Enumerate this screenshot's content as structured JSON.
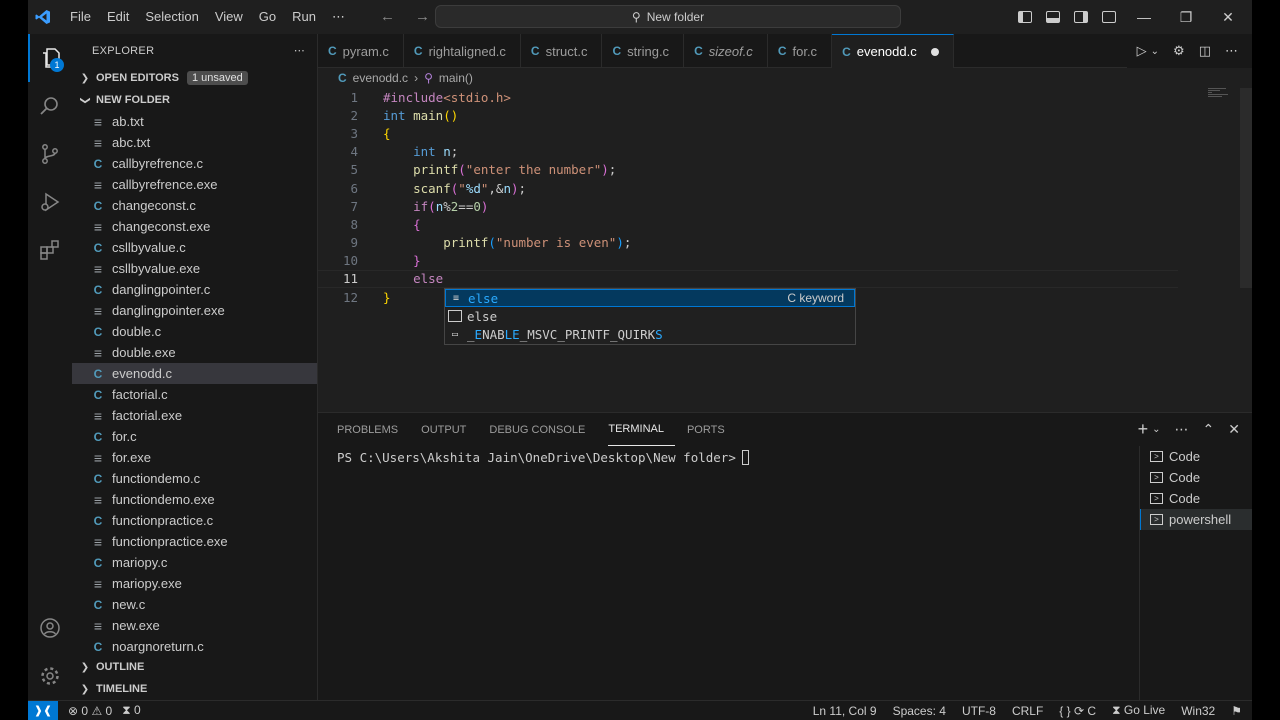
{
  "window": {
    "menu": [
      "File",
      "Edit",
      "Selection",
      "View",
      "Go",
      "Run",
      "⋯"
    ],
    "search": "New folder"
  },
  "explorer": {
    "title": "EXPLORER",
    "open_editors": "OPEN EDITORS",
    "unsaved": "1 unsaved",
    "folder": "NEW FOLDER",
    "files": [
      {
        "name": "ab.txt",
        "type": "txt"
      },
      {
        "name": "abc.txt",
        "type": "txt"
      },
      {
        "name": "callbyrefrence.c",
        "type": "c"
      },
      {
        "name": "callbyrefrence.exe",
        "type": "txt"
      },
      {
        "name": "changeconst.c",
        "type": "c"
      },
      {
        "name": "changeconst.exe",
        "type": "txt"
      },
      {
        "name": "csllbyvalue.c",
        "type": "c"
      },
      {
        "name": "csllbyvalue.exe",
        "type": "txt"
      },
      {
        "name": "danglingpointer.c",
        "type": "c"
      },
      {
        "name": "danglingpointer.exe",
        "type": "txt"
      },
      {
        "name": "double.c",
        "type": "c"
      },
      {
        "name": "double.exe",
        "type": "txt"
      },
      {
        "name": "evenodd.c",
        "type": "c",
        "selected": true
      },
      {
        "name": "factorial.c",
        "type": "c"
      },
      {
        "name": "factorial.exe",
        "type": "txt"
      },
      {
        "name": "for.c",
        "type": "c"
      },
      {
        "name": "for.exe",
        "type": "txt"
      },
      {
        "name": "functiondemo.c",
        "type": "c"
      },
      {
        "name": "functiondemo.exe",
        "type": "txt"
      },
      {
        "name": "functionpractice.c",
        "type": "c"
      },
      {
        "name": "functionpractice.exe",
        "type": "txt"
      },
      {
        "name": "mariopy.c",
        "type": "c"
      },
      {
        "name": "mariopy.exe",
        "type": "txt"
      },
      {
        "name": "new.c",
        "type": "c"
      },
      {
        "name": "new.exe",
        "type": "txt"
      },
      {
        "name": "noargnoreturn.c",
        "type": "c"
      }
    ],
    "outline": "OUTLINE",
    "timeline": "TIMELINE"
  },
  "tabs": [
    {
      "label": "pyram.c",
      "italic": false,
      "active": false
    },
    {
      "label": "rightaligned.c",
      "italic": false,
      "active": false
    },
    {
      "label": "struct.c",
      "italic": false,
      "active": false
    },
    {
      "label": "string.c",
      "italic": false,
      "active": false
    },
    {
      "label": "sizeof.c",
      "italic": true,
      "active": false
    },
    {
      "label": "for.c",
      "italic": false,
      "active": false
    },
    {
      "label": "evenodd.c",
      "italic": false,
      "active": true,
      "dirty": true
    }
  ],
  "breadcrumb": {
    "file": "evenodd.c",
    "symbol": "main()"
  },
  "code": {
    "current_line": 11,
    "line_numbers": [
      "1",
      "2",
      "3",
      "4",
      "5",
      "6",
      "7",
      "8",
      "9",
      "10",
      "11",
      "12"
    ]
  },
  "suggest": [
    {
      "label": "else",
      "detail": "C keyword",
      "icon": "snippet-icon",
      "selected": true
    },
    {
      "label": "else",
      "detail": "",
      "icon": "keyword-icon",
      "selected": false
    },
    {
      "label": "_ENABLE_MSVC_PRINTF_QUIRKS",
      "detail": "",
      "icon": "constant-icon",
      "selected": false
    }
  ],
  "panel": {
    "tabs": [
      "PROBLEMS",
      "OUTPUT",
      "DEBUG CONSOLE",
      "TERMINAL",
      "PORTS"
    ],
    "active_tab": "TERMINAL",
    "prompt": "PS C:\\Users\\Akshita Jain\\OneDrive\\Desktop\\New folder>",
    "terminals": [
      "Code",
      "Code",
      "Code",
      "powershell"
    ],
    "active_terminal": "powershell"
  },
  "status": {
    "errors": "0",
    "warnings": "0",
    "ports": "0",
    "position": "Ln 11, Col 9",
    "spaces": "Spaces: 4",
    "encoding": "UTF-8",
    "eol": "CRLF",
    "language": "C",
    "golive": "Go Live",
    "platform": "Win32"
  },
  "colors": {
    "accent": "#0078d4",
    "editor_bg": "#1f1f1f",
    "sidebar_bg": "#181818"
  }
}
